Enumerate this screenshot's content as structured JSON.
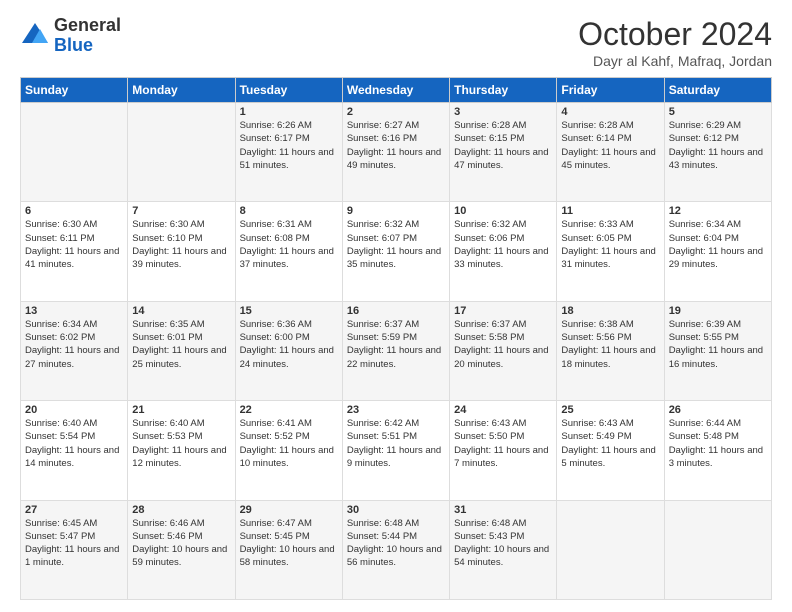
{
  "header": {
    "logo_general": "General",
    "logo_blue": "Blue",
    "month_title": "October 2024",
    "location": "Dayr al Kahf, Mafraq, Jordan"
  },
  "weekdays": [
    "Sunday",
    "Monday",
    "Tuesday",
    "Wednesday",
    "Thursday",
    "Friday",
    "Saturday"
  ],
  "weeks": [
    [
      {
        "day": "",
        "sunrise": "",
        "sunset": "",
        "daylight": ""
      },
      {
        "day": "",
        "sunrise": "",
        "sunset": "",
        "daylight": ""
      },
      {
        "day": "1",
        "sunrise": "Sunrise: 6:26 AM",
        "sunset": "Sunset: 6:17 PM",
        "daylight": "Daylight: 11 hours and 51 minutes."
      },
      {
        "day": "2",
        "sunrise": "Sunrise: 6:27 AM",
        "sunset": "Sunset: 6:16 PM",
        "daylight": "Daylight: 11 hours and 49 minutes."
      },
      {
        "day": "3",
        "sunrise": "Sunrise: 6:28 AM",
        "sunset": "Sunset: 6:15 PM",
        "daylight": "Daylight: 11 hours and 47 minutes."
      },
      {
        "day": "4",
        "sunrise": "Sunrise: 6:28 AM",
        "sunset": "Sunset: 6:14 PM",
        "daylight": "Daylight: 11 hours and 45 minutes."
      },
      {
        "day": "5",
        "sunrise": "Sunrise: 6:29 AM",
        "sunset": "Sunset: 6:12 PM",
        "daylight": "Daylight: 11 hours and 43 minutes."
      }
    ],
    [
      {
        "day": "6",
        "sunrise": "Sunrise: 6:30 AM",
        "sunset": "Sunset: 6:11 PM",
        "daylight": "Daylight: 11 hours and 41 minutes."
      },
      {
        "day": "7",
        "sunrise": "Sunrise: 6:30 AM",
        "sunset": "Sunset: 6:10 PM",
        "daylight": "Daylight: 11 hours and 39 minutes."
      },
      {
        "day": "8",
        "sunrise": "Sunrise: 6:31 AM",
        "sunset": "Sunset: 6:08 PM",
        "daylight": "Daylight: 11 hours and 37 minutes."
      },
      {
        "day": "9",
        "sunrise": "Sunrise: 6:32 AM",
        "sunset": "Sunset: 6:07 PM",
        "daylight": "Daylight: 11 hours and 35 minutes."
      },
      {
        "day": "10",
        "sunrise": "Sunrise: 6:32 AM",
        "sunset": "Sunset: 6:06 PM",
        "daylight": "Daylight: 11 hours and 33 minutes."
      },
      {
        "day": "11",
        "sunrise": "Sunrise: 6:33 AM",
        "sunset": "Sunset: 6:05 PM",
        "daylight": "Daylight: 11 hours and 31 minutes."
      },
      {
        "day": "12",
        "sunrise": "Sunrise: 6:34 AM",
        "sunset": "Sunset: 6:04 PM",
        "daylight": "Daylight: 11 hours and 29 minutes."
      }
    ],
    [
      {
        "day": "13",
        "sunrise": "Sunrise: 6:34 AM",
        "sunset": "Sunset: 6:02 PM",
        "daylight": "Daylight: 11 hours and 27 minutes."
      },
      {
        "day": "14",
        "sunrise": "Sunrise: 6:35 AM",
        "sunset": "Sunset: 6:01 PM",
        "daylight": "Daylight: 11 hours and 25 minutes."
      },
      {
        "day": "15",
        "sunrise": "Sunrise: 6:36 AM",
        "sunset": "Sunset: 6:00 PM",
        "daylight": "Daylight: 11 hours and 24 minutes."
      },
      {
        "day": "16",
        "sunrise": "Sunrise: 6:37 AM",
        "sunset": "Sunset: 5:59 PM",
        "daylight": "Daylight: 11 hours and 22 minutes."
      },
      {
        "day": "17",
        "sunrise": "Sunrise: 6:37 AM",
        "sunset": "Sunset: 5:58 PM",
        "daylight": "Daylight: 11 hours and 20 minutes."
      },
      {
        "day": "18",
        "sunrise": "Sunrise: 6:38 AM",
        "sunset": "Sunset: 5:56 PM",
        "daylight": "Daylight: 11 hours and 18 minutes."
      },
      {
        "day": "19",
        "sunrise": "Sunrise: 6:39 AM",
        "sunset": "Sunset: 5:55 PM",
        "daylight": "Daylight: 11 hours and 16 minutes."
      }
    ],
    [
      {
        "day": "20",
        "sunrise": "Sunrise: 6:40 AM",
        "sunset": "Sunset: 5:54 PM",
        "daylight": "Daylight: 11 hours and 14 minutes."
      },
      {
        "day": "21",
        "sunrise": "Sunrise: 6:40 AM",
        "sunset": "Sunset: 5:53 PM",
        "daylight": "Daylight: 11 hours and 12 minutes."
      },
      {
        "day": "22",
        "sunrise": "Sunrise: 6:41 AM",
        "sunset": "Sunset: 5:52 PM",
        "daylight": "Daylight: 11 hours and 10 minutes."
      },
      {
        "day": "23",
        "sunrise": "Sunrise: 6:42 AM",
        "sunset": "Sunset: 5:51 PM",
        "daylight": "Daylight: 11 hours and 9 minutes."
      },
      {
        "day": "24",
        "sunrise": "Sunrise: 6:43 AM",
        "sunset": "Sunset: 5:50 PM",
        "daylight": "Daylight: 11 hours and 7 minutes."
      },
      {
        "day": "25",
        "sunrise": "Sunrise: 6:43 AM",
        "sunset": "Sunset: 5:49 PM",
        "daylight": "Daylight: 11 hours and 5 minutes."
      },
      {
        "day": "26",
        "sunrise": "Sunrise: 6:44 AM",
        "sunset": "Sunset: 5:48 PM",
        "daylight": "Daylight: 11 hours and 3 minutes."
      }
    ],
    [
      {
        "day": "27",
        "sunrise": "Sunrise: 6:45 AM",
        "sunset": "Sunset: 5:47 PM",
        "daylight": "Daylight: 11 hours and 1 minute."
      },
      {
        "day": "28",
        "sunrise": "Sunrise: 6:46 AM",
        "sunset": "Sunset: 5:46 PM",
        "daylight": "Daylight: 10 hours and 59 minutes."
      },
      {
        "day": "29",
        "sunrise": "Sunrise: 6:47 AM",
        "sunset": "Sunset: 5:45 PM",
        "daylight": "Daylight: 10 hours and 58 minutes."
      },
      {
        "day": "30",
        "sunrise": "Sunrise: 6:48 AM",
        "sunset": "Sunset: 5:44 PM",
        "daylight": "Daylight: 10 hours and 56 minutes."
      },
      {
        "day": "31",
        "sunrise": "Sunrise: 6:48 AM",
        "sunset": "Sunset: 5:43 PM",
        "daylight": "Daylight: 10 hours and 54 minutes."
      },
      {
        "day": "",
        "sunrise": "",
        "sunset": "",
        "daylight": ""
      },
      {
        "day": "",
        "sunrise": "",
        "sunset": "",
        "daylight": ""
      }
    ]
  ]
}
